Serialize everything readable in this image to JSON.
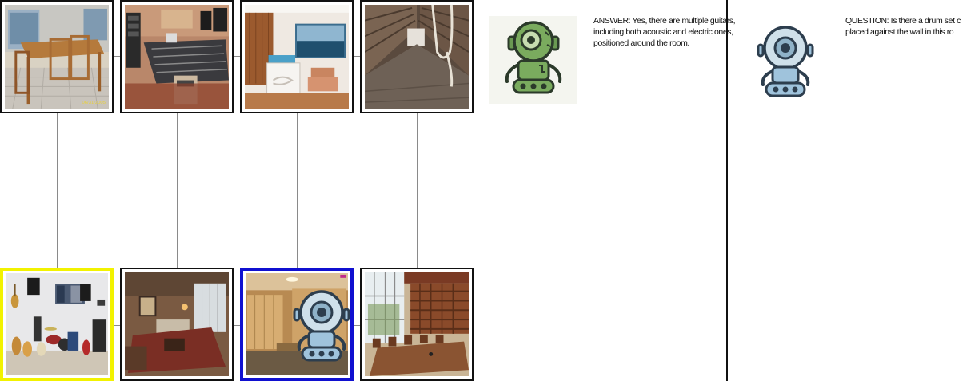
{
  "answer_text": "ANSWER: Yes, there are multiple guitars,\nincluding both acoustic and electric ones,\npositioned around the room.",
  "question_text": "QUESTION: Is there a drum set c\nplaced against the wall in this ro",
  "top_row": [
    {
      "name": "dining-room",
      "date_stamp": "06/31/2005"
    },
    {
      "name": "recording-studio"
    },
    {
      "name": "reception-lobby"
    },
    {
      "name": "attic"
    }
  ],
  "bottom_row": [
    {
      "name": "music-room",
      "selected": "yellow"
    },
    {
      "name": "living-room"
    },
    {
      "name": "locker-room",
      "selected": "blue",
      "overlay": "robot-icon"
    },
    {
      "name": "library-conference-room"
    }
  ],
  "colors": {
    "selected_yellow": "#f2f200",
    "selected_blue": "#1010d0",
    "robot_green": "#6a9a52",
    "robot_blue": "#9fc3dc",
    "robot_outline": "#2d3e4e"
  }
}
